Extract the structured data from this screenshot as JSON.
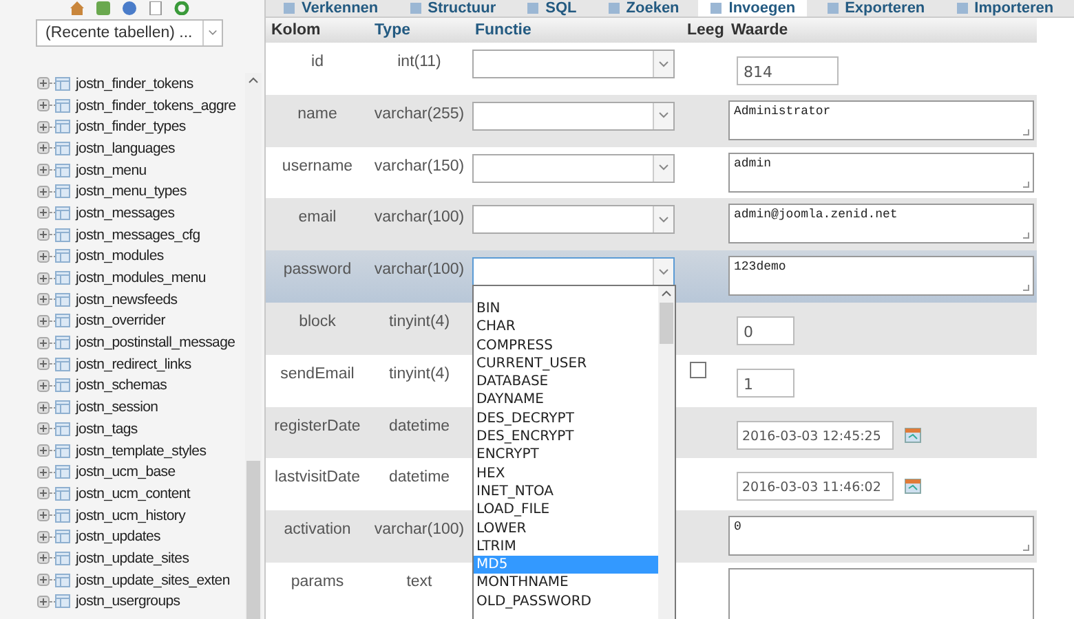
{
  "sidebar": {
    "recent_tables": "(Recente tabellen) ...",
    "tables": [
      "jostn_finder_tokens",
      "jostn_finder_tokens_aggre",
      "jostn_finder_types",
      "jostn_languages",
      "jostn_menu",
      "jostn_menu_types",
      "jostn_messages",
      "jostn_messages_cfg",
      "jostn_modules",
      "jostn_modules_menu",
      "jostn_newsfeeds",
      "jostn_overrider",
      "jostn_postinstall_message",
      "jostn_redirect_links",
      "jostn_schemas",
      "jostn_session",
      "jostn_tags",
      "jostn_template_styles",
      "jostn_ucm_base",
      "jostn_ucm_content",
      "jostn_ucm_history",
      "jostn_updates",
      "jostn_update_sites",
      "jostn_update_sites_exten",
      "jostn_usergroups"
    ]
  },
  "tabs": [
    {
      "label": "Verkennen",
      "selected": false
    },
    {
      "label": "Structuur",
      "selected": false
    },
    {
      "label": "SQL",
      "selected": false
    },
    {
      "label": "Zoeken",
      "selected": false
    },
    {
      "label": "Invoegen",
      "selected": true
    },
    {
      "label": "Exporteren",
      "selected": false
    },
    {
      "label": "Importeren",
      "selected": false
    }
  ],
  "table": {
    "columns": [
      "Kolom",
      "Type",
      "Functie",
      "Leeg",
      "Waarde"
    ],
    "rows": [
      {
        "name": "id",
        "type": "int(11)",
        "function_select": true,
        "selected": false,
        "value": {
          "kind": "input",
          "text": "814"
        }
      },
      {
        "name": "name",
        "type": "varchar(255)",
        "function_select": true,
        "selected": false,
        "value": {
          "kind": "textarea",
          "text": "Administrator"
        }
      },
      {
        "name": "username",
        "type": "varchar(150)",
        "function_select": true,
        "selected": false,
        "value": {
          "kind": "textarea",
          "text": "admin"
        }
      },
      {
        "name": "email",
        "type": "varchar(100)",
        "function_select": true,
        "selected": false,
        "value": {
          "kind": "textarea",
          "text": "admin@joomla.zenid.net"
        }
      },
      {
        "name": "password",
        "type": "varchar(100)",
        "function_select": true,
        "selected": true,
        "value": {
          "kind": "textarea",
          "text": "123demo"
        }
      },
      {
        "name": "block",
        "type": "tinyint(4)",
        "selected": false,
        "value": {
          "kind": "short",
          "text": "0"
        }
      },
      {
        "name": "sendEmail",
        "type": "tinyint(4)",
        "selected": false,
        "null_checkbox": {
          "checked": false
        },
        "value": {
          "kind": "short",
          "text": "1"
        }
      },
      {
        "name": "registerDate",
        "type": "datetime",
        "selected": false,
        "value": {
          "kind": "datetime",
          "text": "2016-03-03 12:45:25"
        }
      },
      {
        "name": "lastvisitDate",
        "type": "datetime",
        "selected": false,
        "value": {
          "kind": "datetime",
          "text": "2016-03-03 11:46:02"
        }
      },
      {
        "name": "activation",
        "type": "varchar(100)",
        "selected": false,
        "value": {
          "kind": "textarea",
          "text": "0"
        }
      },
      {
        "name": "params",
        "type": "text",
        "selected": false,
        "value": {
          "kind": "textarea"
        }
      }
    ]
  },
  "function_dropdown": {
    "options": [
      {
        "label": "BIN",
        "selected": false
      },
      {
        "label": "CHAR",
        "selected": false
      },
      {
        "label": "COMPRESS",
        "selected": false
      },
      {
        "label": "CURRENT_USER",
        "selected": false
      },
      {
        "label": "DATABASE",
        "selected": false
      },
      {
        "label": "DAYNAME",
        "selected": false
      },
      {
        "label": "DES_DECRYPT",
        "selected": false
      },
      {
        "label": "DES_ENCRYPT",
        "selected": false
      },
      {
        "label": "ENCRYPT",
        "selected": false
      },
      {
        "label": "HEX",
        "selected": false
      },
      {
        "label": "INET_NTOA",
        "selected": false
      },
      {
        "label": "LOAD_FILE",
        "selected": false
      },
      {
        "label": "LOWER",
        "selected": false
      },
      {
        "label": "LTRIM",
        "selected": false
      },
      {
        "label": "MD5",
        "selected": true
      },
      {
        "label": "MONTHNAME",
        "selected": false
      },
      {
        "label": "OLD_PASSWORD",
        "selected": false
      }
    ]
  }
}
